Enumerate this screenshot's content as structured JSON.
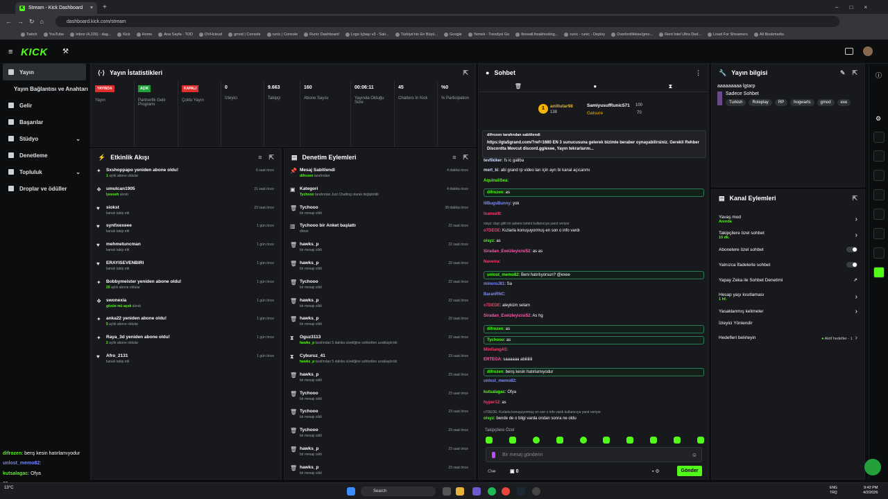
{
  "browser": {
    "tab_title": "Stream - Kick Dashboard",
    "url": "dashboard.kick.com/stream",
    "bookmarks": [
      "Twitch",
      "YouTube",
      "Inbox (4,226) - dag...",
      "Kick",
      "Home",
      "Ana Sayfa - TOD",
      "OVHcloud",
      "gmod | Console",
      "runic | Console",
      "Runic Dashboard",
      "Logo İçbaşı v3 - Satı...",
      "Türkiye'nin En Büyü...",
      "Google",
      "Yemek - Trendyol Go",
      "firewall.freakhosting...",
      "runic - runic - Deploy",
      "OverlordIkkise/gmo...",
      "Rent Intel Ultra Ded...",
      "Lixad For Streamers",
      "All Bookmarks"
    ]
  },
  "brand": "KICK",
  "sidebar": [
    {
      "label": "Yayın"
    },
    {
      "label": "Yayın Bağlantısı ve Anahtarı"
    },
    {
      "label": "Gelir"
    },
    {
      "label": "Başarılar"
    },
    {
      "label": "Stüdyo"
    },
    {
      "label": "Denetleme"
    },
    {
      "label": "Topluluk"
    },
    {
      "label": "Droplar ve ödüller"
    }
  ],
  "stats": {
    "title": "Yayın İstatistikleri",
    "items": [
      {
        "badge": "YAYINDA",
        "badge_color": "#e02d2d",
        "label": "Yayın"
      },
      {
        "badge": "AÇIK",
        "badge_color": "#23a03a",
        "label": "Partnerlik Gelir Programı"
      },
      {
        "badge": "KAPALI",
        "badge_color": "#e02d2d",
        "label": "Çoklu Yayın"
      },
      {
        "value": "0",
        "label": "İzleyici"
      },
      {
        "value": "9.663",
        "label": "Takipçi"
      },
      {
        "value": "160",
        "label": "Abone Sayısı"
      },
      {
        "value": "00:06:11",
        "label": "Yayında Olduğu Süre"
      },
      {
        "value": "45",
        "label": "Chatters In Kick"
      },
      {
        "value": "%0",
        "label": "% Participation"
      }
    ]
  },
  "activity": {
    "title": "Etkinlik Akışı",
    "items": [
      {
        "icon": "star",
        "title": "Sxshoppapo yeniden abone oldu!",
        "sub_hl": "1",
        "sub": " aylık abone oldular",
        "time": "6 saat önce"
      },
      {
        "icon": "gift",
        "title": "umutcan1905",
        "sub_hl": "lyeeseh",
        "sub": " alındı",
        "time": "21 saat önce"
      },
      {
        "icon": "heart",
        "title": "siokst",
        "sub_hl": "",
        "sub": "kanalı takip etti",
        "time": "23 saat önce"
      },
      {
        "icon": "heart",
        "title": "synt\\xexeee",
        "sub_hl": "",
        "sub": "kanalı takip etti",
        "time": "1 gün önce"
      },
      {
        "icon": "heart",
        "title": "mehmetuncman",
        "sub_hl": "",
        "sub": "kanalı takip etti",
        "time": "1 gün önce"
      },
      {
        "icon": "heart",
        "title": "ERAYISEVENBIRI",
        "sub_hl": "",
        "sub": "kanalı takip etti",
        "time": "1 gün önce"
      },
      {
        "icon": "star",
        "title": "Bobbymeister yeniden abone oldu!",
        "sub_hl": "20",
        "sub": " aylık abone oldular",
        "time": "1 gün önce"
      },
      {
        "icon": "gift",
        "title": "swonexia",
        "sub_hl": "gözün mü açıdı",
        "sub": " alındı",
        "time": "1 gün önce"
      },
      {
        "icon": "star",
        "title": "anka22 yeniden abone oldu!",
        "sub_hl": "5",
        "sub": " aylık abone oldular",
        "time": "1 gün önce"
      },
      {
        "icon": "star",
        "title": "Raya_3d yeniden abone oldu!",
        "sub_hl": "2",
        "sub": " aylık abone oldular",
        "time": "1 gün önce"
      },
      {
        "icon": "heart",
        "title": "Afro_2131",
        "sub_hl": "",
        "sub": "kanalı takip etti",
        "time": "1 gün önce"
      }
    ]
  },
  "moderation": {
    "title": "Denetim Eylemleri",
    "items": [
      {
        "icon": "pin",
        "title": "Mesaj Sabitlendi",
        "sub_hl": "difrozen",
        "sub": " tarafından",
        "time": "4 dakika önce"
      },
      {
        "icon": "cat",
        "title": "Kategori",
        "sub_hl": "Tychooo",
        "sub": " tarafından Just Chatting olarak değiştirildi",
        "time": "4 dakika önce"
      },
      {
        "icon": "trash",
        "title": "Tychooo",
        "sub_hl": "",
        "sub": "bir mesajı sildi",
        "time": "39 dakika önce"
      },
      {
        "icon": "poll",
        "title": "Tychooo bir Anket başlattı",
        "sub_hl": "",
        "sub": "döner",
        "time": "22 saat önce"
      },
      {
        "icon": "trash",
        "title": "hawks_p",
        "sub_hl": "",
        "sub": "bir mesajı sildi",
        "time": "22 saat önce"
      },
      {
        "icon": "trash",
        "title": "hawks_p",
        "sub_hl": "",
        "sub": "bir mesajı sildi",
        "time": "22 saat önce"
      },
      {
        "icon": "trash",
        "title": "Tychooo",
        "sub_hl": "",
        "sub": "bir mesajı sildi",
        "time": "22 saat önce"
      },
      {
        "icon": "trash",
        "title": "hawks_p",
        "sub_hl": "",
        "sub": "bir mesajı sildi",
        "time": "22 saat önce"
      },
      {
        "icon": "trash",
        "title": "hawks_p",
        "sub_hl": "",
        "sub": "bir mesajı sildi",
        "time": "22 saat önce"
      },
      {
        "icon": "time",
        "title": "Oguz3113",
        "sub_hl": "hawks_p",
        "sub": " tarafından 5 dakika süreliğine sohbetten uzaklaştırıldı",
        "time": "22 saat önce"
      },
      {
        "icon": "time",
        "title": "Cyburuz_41",
        "sub_hl": "hawks_p",
        "sub": " tarafından 5 dakika süreliğine sohbetten uzaklaştırıldı",
        "time": "23 saat önce"
      },
      {
        "icon": "trash",
        "title": "hawks_p",
        "sub_hl": "",
        "sub": "bir mesajı sildi",
        "time": "23 saat önce"
      },
      {
        "icon": "trash",
        "title": "Tychooo",
        "sub_hl": "",
        "sub": "bir mesajı sildi",
        "time": "23 saat önce"
      },
      {
        "icon": "trash",
        "title": "Tychooo",
        "sub_hl": "",
        "sub": "bir mesajı sildi",
        "time": "23 saat önce"
      },
      {
        "icon": "trash",
        "title": "Tychooo",
        "sub_hl": "",
        "sub": "bir mesajı sildi",
        "time": "23 saat önce"
      },
      {
        "icon": "trash",
        "title": "hawks_p",
        "sub_hl": "",
        "sub": "bir mesajı sildi",
        "time": "23 saat önce"
      },
      {
        "icon": "trash",
        "title": "hawks_p",
        "sub_hl": "",
        "sub": "bir mesajı sildi",
        "time": "23 saat önce"
      }
    ]
  },
  "chat": {
    "title": "Sohbet",
    "leader1_name": "aniltutar98",
    "leader1_count": "138",
    "leader2_name": "SamiyusufRunic571",
    "leader2_count": "100",
    "leader3_name": "Gatsure",
    "leader3_count": "70",
    "pinned_by": "difrozen tarafından sabitlendi",
    "pinned_text": "https://gta5grand.com/?ref=1680 EN 3 sunucusuna gelerek bizimle beraber oynayabilirsiniz. Gerekli Rehber Discordta Mevcut discord.gg/exee, Yayın tekrarlarını...",
    "messages": [
      {
        "u": "tevfikiker",
        "c": "#cfe0ff",
        "t": ": fs ic galiba",
        "box": false
      },
      {
        "u": "mert_ki",
        "c": "#cfe0ff",
        "t": ": abi grand rp video ları için ayrı bi kanal açıcanmı",
        "box": false
      },
      {
        "u": "AquinaliSea",
        "c": "#53fc18",
        "t": ":",
        "box": false
      },
      {
        "u": "difrozen",
        "c": "#53fc18",
        "t": ": as",
        "box": true
      },
      {
        "u": "IllBugsBunny",
        "c": "#7b8cff",
        "t": ": yok",
        "box": false
      },
      {
        "u": "loaneal8",
        "c": "#ff3a6e",
        "t": ":",
        "box": false
      },
      {
        "u": "",
        "c": "#9ba0a4",
        "t": "oisyz: dayı gitti mi askere ismini kullanıcıya yanıt veriyor",
        "box": false
      },
      {
        "u": "o7DEDE",
        "c": "#ff3a6e",
        "t": ": Kızlarla konuşuyormuş en son o info vardı",
        "box": false
      },
      {
        "u": "oisyz",
        "c": "#53fc18",
        "t": ": as",
        "box": false
      },
      {
        "u": "Siradan_Exelzleyicisi52",
        "c": "#ff5ab0",
        "t": ": as as",
        "box": false
      },
      {
        "u": "Naverra",
        "c": "#ff3a6e",
        "t": ":",
        "box": false
      },
      {
        "u": "unlost_memo82",
        "c": "#53fc18",
        "t": ": Beni hatırlıyorsun? @exee",
        "box": true
      },
      {
        "u": "minoruJ81",
        "c": "#7b8cff",
        "t": ": Sa",
        "box": false
      },
      {
        "u": "BaranRNC",
        "c": "#7b8cff",
        "t": ":",
        "box": false
      },
      {
        "u": "o7DEDE",
        "c": "#ff3a6e",
        "t": ": aleyküm selam",
        "box": false
      },
      {
        "u": "Siradan_Exelzleyicisi52",
        "c": "#ff5ab0",
        "t": ": As hg",
        "box": false
      },
      {
        "u": "difrozen",
        "c": "#53fc18",
        "t": ": as",
        "box": true
      },
      {
        "u": "Tychooo",
        "c": "#53fc18",
        "t": ": as",
        "box": true
      },
      {
        "u": "MinGangA5",
        "c": "#ff3a6e",
        "t": ":",
        "box": false
      },
      {
        "u": "ERTEGA",
        "c": "#ff5ab0",
        "t": ": saaaaaa abiiiiiiii",
        "box": false
      },
      {
        "u": "difrozen",
        "c": "#53fc18",
        "t": ": benş kesin hatırlamıyodur",
        "box": true
      },
      {
        "u": "unlost_memo82",
        "c": "#7b8cff",
        "t": ":",
        "box": false
      },
      {
        "u": "kutsalagac",
        "c": "#53fc18",
        "t": ": Ofya",
        "box": false
      },
      {
        "u": "hyper12",
        "c": "#ff3a6e",
        "t": ": as",
        "box": false
      },
      {
        "u": "",
        "c": "#9ba0a4",
        "t": "o7DEDE: Kızlarla konuşuyormuş en son o info vardı kullanıcıya yanıt veriyor",
        "box": false
      },
      {
        "u": "oisyz",
        "c": "#53fc18",
        "t": ": bende de o bilgi varda ondan sonra ne oldu",
        "box": false
      }
    ],
    "followers_only": "Takipçilere Özel",
    "input_placeholder": "Bir mesaj gönderin",
    "send": "Gönder",
    "count": "0"
  },
  "stream_info": {
    "title": "Yayın bilgisi",
    "stream_title": "aaaaaaaaa lgtarp",
    "category": "Sadece Sohbet",
    "tags": [
      "Turkish",
      "Roleplay",
      "RP",
      "hogwarts",
      "gmod",
      "exe"
    ]
  },
  "channel": {
    "title": "Kanal Eylemleri",
    "items": [
      {
        "label": "Yavaş mod",
        "sub": "Anında",
        "ctrl": "chev"
      },
      {
        "label": "Takipçilere özel sohbet",
        "sub": "10 dk.",
        "ctrl": "chev"
      },
      {
        "label": "Abonelere özel sohbet",
        "sub": "",
        "ctrl": "toggle"
      },
      {
        "label": "Yalnızca İfadelerle sohbet",
        "sub": "",
        "ctrl": "toggle"
      },
      {
        "label": "Yapay Zeka ile Sohbet Denetimi",
        "sub": "",
        "ctrl": "ext"
      },
      {
        "label": "Hesap yaşı kısıtlaması",
        "sub": "1 hf.",
        "ctrl": "chev"
      },
      {
        "label": "Yasaklanmış kelimeler",
        "sub": "",
        "ctrl": "chev"
      },
      {
        "label": "İzleyici Yönlendir",
        "sub": "",
        "ctrl": ""
      },
      {
        "label": "Hedefleri belirleyin",
        "sub": "",
        "ctrl": "goal",
        "extra": "Aktif hedefler - 1"
      }
    ]
  },
  "overlay": [
    {
      "u": "difrozen",
      "t": ": benş kesin hatırlamıyodur",
      "c": "#53fc18"
    },
    {
      "u": "unlost_memo82",
      "t": ":",
      "c": "#7b8cff"
    },
    {
      "u": "kutsalagac",
      "t": ": Ofya",
      "c": "#53fc18"
    },
    {
      "u": "",
      "t": "as",
      "c": "#ff3a6e"
    },
    {
      "u": "oisyz",
      "t": ": bende de o bilgi varda ondan sonra ne oldu",
      "c": "#53fc18"
    }
  ],
  "taskbar": {
    "search": "Search",
    "weather": "13°C",
    "lang1": "ENG",
    "lang2": "TRQ",
    "time": "9:42 PM",
    "date": "4/2/2026"
  }
}
